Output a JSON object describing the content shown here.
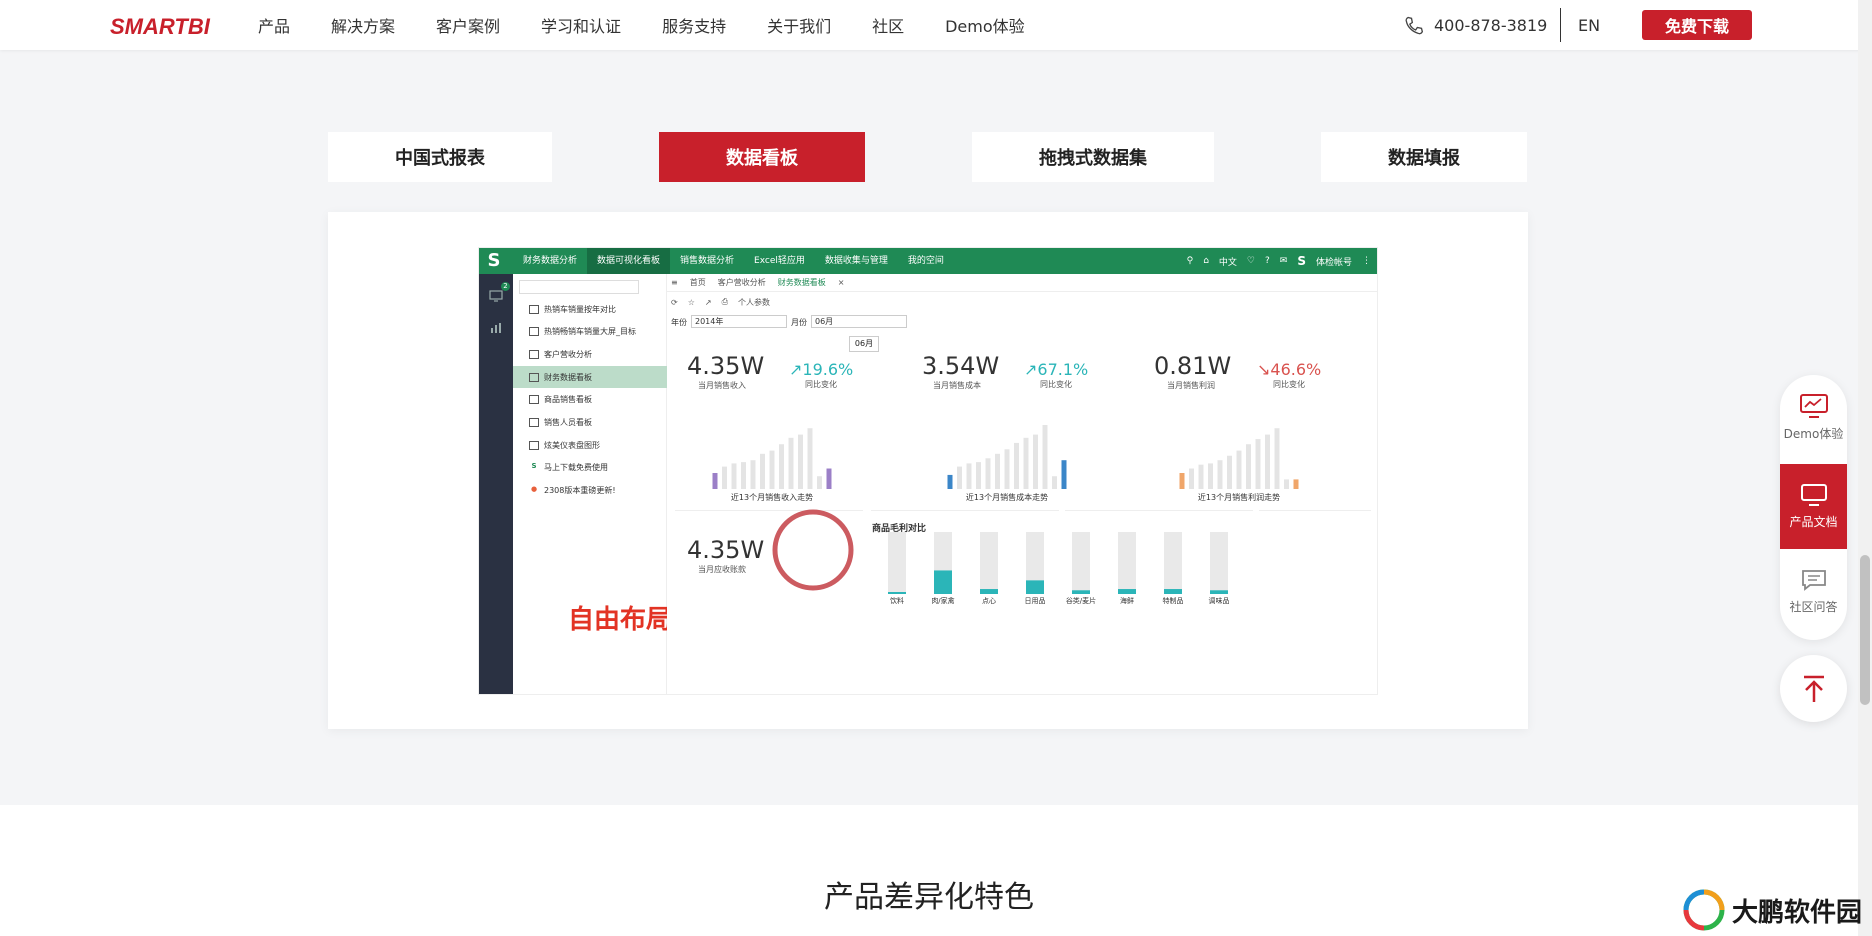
{
  "nav": {
    "logo": "SMARTBI",
    "items": [
      "产品",
      "解决方案",
      "客户案例",
      "学习和认证",
      "服务支持",
      "关于我们",
      "社区",
      "Demo体验"
    ],
    "phone": "400-878-3819",
    "lang": "EN",
    "download": "免费下载"
  },
  "feature_tabs": [
    {
      "label": "中国式报表"
    },
    {
      "label": "数据看板"
    },
    {
      "label": "拖拽式数据集"
    },
    {
      "label": "数据填报"
    }
  ],
  "dashboard": {
    "top_tabs": [
      "财务数据分析",
      "数据可视化看板",
      "销售数据分析",
      "Excel轻应用",
      "数据收集与管理",
      "我的空间"
    ],
    "top_right": {
      "lang": "中文",
      "account": "体检帐号"
    },
    "tree_items": [
      {
        "label": "热销车销量按年对比",
        "icon": "table-icon"
      },
      {
        "label": "热销畅销车销量大屏_目标",
        "icon": "table-icon"
      },
      {
        "label": "客户营收分析",
        "icon": "table-icon"
      },
      {
        "label": "财务数据看板",
        "icon": "table-icon"
      },
      {
        "label": "商品销售看板",
        "icon": "table-icon"
      },
      {
        "label": "销售人员看板",
        "icon": "table-icon"
      },
      {
        "label": "炫美仪表盘图形",
        "icon": "table-icon"
      },
      {
        "label": "马上下载免费使用",
        "icon": "s-logo-icon"
      },
      {
        "label": "2308版本重磅更新!",
        "icon": "fire-icon"
      }
    ],
    "badge": "2",
    "crumbs": {
      "home": "首页",
      "tab1": "客户营收分析",
      "tab2": "财务数据看板"
    },
    "toolbar": {
      "params": "个人参数"
    },
    "filters": {
      "year_label": "年份",
      "year": "2014年",
      "month_label": "月份",
      "month": "06月"
    },
    "tooltip": "06月",
    "kpis": [
      {
        "value": "4.35W",
        "label": "当月销售收入",
        "pct": "↗19.6%",
        "pct_label": "同比变化",
        "up": true
      },
      {
        "value": "3.54W",
        "label": "当月销售成本",
        "pct": "↗67.1%",
        "pct_label": "同比变化",
        "up": true
      },
      {
        "value": "0.81W",
        "label": "当月销售利润",
        "pct": "↘46.6%",
        "pct_label": "同比变化",
        "up": false
      }
    ],
    "trend_labels": [
      "近13个月销售收入走势",
      "近13个月销售成本走势",
      "近13个月销售利润走势"
    ],
    "trend_colors": [
      "#9b7fc7",
      "#3b86c8",
      "#f0a66a"
    ],
    "trend_values": [
      [
        0.25,
        0.35,
        0.4,
        0.42,
        0.45,
        0.55,
        0.6,
        0.7,
        0.8,
        0.85,
        0.95,
        0.2,
        0.32
      ],
      [
        0.22,
        0.35,
        0.4,
        0.42,
        0.48,
        0.55,
        0.62,
        0.72,
        0.8,
        0.85,
        1.0,
        0.2,
        0.45
      ],
      [
        0.25,
        0.32,
        0.38,
        0.4,
        0.45,
        0.52,
        0.6,
        0.7,
        0.78,
        0.85,
        0.95,
        0.15,
        0.15
      ]
    ],
    "receivable": {
      "value": "4.35W",
      "label": "当月应收账款"
    },
    "gross": {
      "title": "商品毛利对比",
      "labels": [
        "饮料",
        "肉/家禽",
        "点心",
        "日用品",
        "谷类/麦片",
        "海鲜",
        "特制品",
        "调味品"
      ],
      "fill": [
        0.03,
        0.38,
        0.08,
        0.22,
        0.06,
        0.08,
        0.08,
        0.06
      ]
    },
    "free_layout": "自由布局"
  },
  "float_bar": {
    "demo": "Demo体验",
    "docs": "产品文档",
    "qa": "社区问答"
  },
  "section_title": "产品差异化特色",
  "watermark": "大鹏软件园",
  "colors": {
    "brand": "#c8202b",
    "green": "#1f8a55",
    "teal": "#2bb5b8"
  }
}
